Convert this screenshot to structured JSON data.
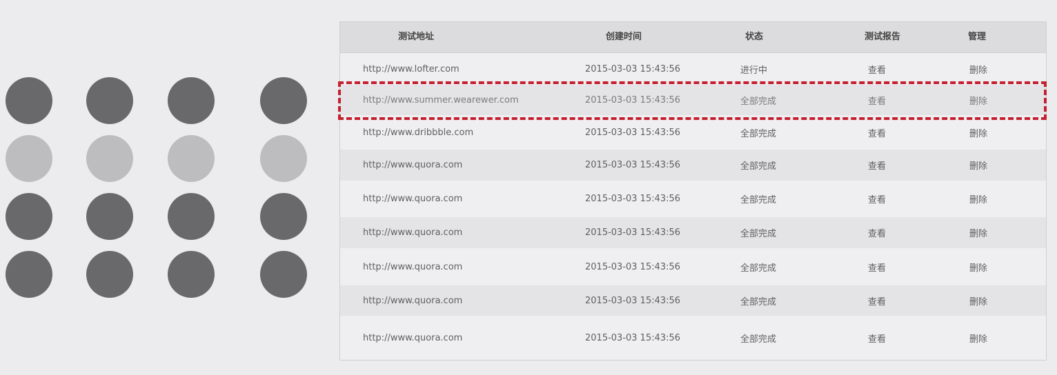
{
  "table": {
    "headers": {
      "url": "测试地址",
      "created": "创建时间",
      "status": "状态",
      "report": "测试报告",
      "manage": "管理"
    },
    "rows": [
      {
        "url": "http://www.lofter.com",
        "created": "2015-03-03 15:43:56",
        "status": "进行中",
        "report": "查看",
        "manage": "删除"
      },
      {
        "url": "http://www.summer.wearewer.com",
        "created": "2015-03-03 15:43:56",
        "status": "全部完成",
        "report": "查看",
        "manage": "删除"
      },
      {
        "url": "http://www.dribbble.com",
        "created": "2015-03-03 15:43:56",
        "status": "全部完成",
        "report": "查看",
        "manage": "删除"
      },
      {
        "url": "http://www.quora.com",
        "created": "2015-03-03 15:43:56",
        "status": "全部完成",
        "report": "查看",
        "manage": "删除"
      },
      {
        "url": "http://www.quora.com",
        "created": "2015-03-03 15:43:56",
        "status": "全部完成",
        "report": "查看",
        "manage": "删除"
      },
      {
        "url": "http://www.quora.com",
        "created": "2015-03-03 15:43:56",
        "status": "全部完成",
        "report": "查看",
        "manage": "删除"
      },
      {
        "url": "http://www.quora.com",
        "created": "2015-03-03 15:43:56",
        "status": "全部完成",
        "report": "查看",
        "manage": "删除"
      },
      {
        "url": "http://www.quora.com",
        "created": "2015-03-03 15:43:56",
        "status": "全部完成",
        "report": "查看",
        "manage": "删除"
      },
      {
        "url": "http://www.quora.com",
        "created": "2015-03-03 15:43:56",
        "status": "全部完成",
        "report": "查看",
        "manage": "删除"
      }
    ]
  },
  "dot_grid": {
    "rows": [
      {
        "shade": "dark"
      },
      {
        "shade": "light"
      },
      {
        "shade": "dark"
      },
      {
        "shade": "dark"
      }
    ],
    "columns": 4
  },
  "colors": {
    "background": "#ececee",
    "dot_dark": "#69686a",
    "dot_light": "#bdbdbf",
    "header_bg": "#dcdcde",
    "row_alt_bg": "#e4e4e6",
    "highlight_border": "#c42030"
  }
}
